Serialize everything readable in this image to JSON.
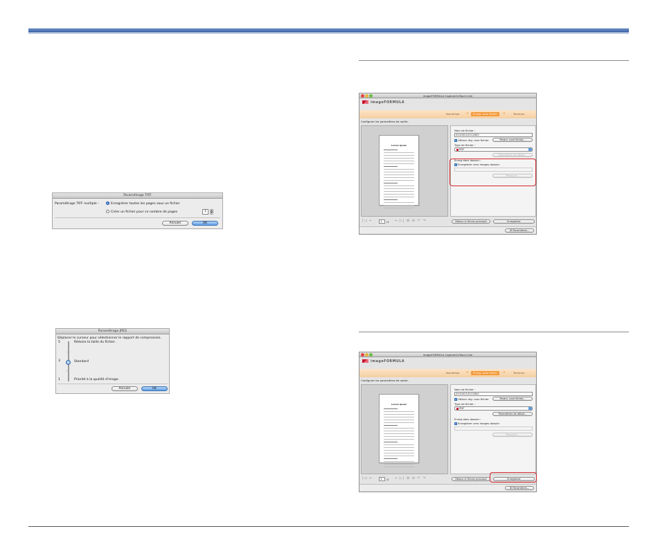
{
  "tiff_dialog": {
    "title": "Paramétrage TIFF",
    "label": "Paramétrage TIFF multiple :",
    "opt_all": "Enregistrer toutes les pages sous un fichier",
    "opt_split": "Créer un fichier pour ce nombre de pages",
    "pages_value": "1",
    "cancel": "Annuler",
    "ok": "OK"
  },
  "jpeg_dialog": {
    "title": "Paramétrage JPEG",
    "instruction": "Déplacer le curseur pour sélectionner le rapport de compression.",
    "level_top": "5",
    "level_mid": "3",
    "level_bottom": "1",
    "label_top": "Réduire la taille du fichier.",
    "label_mid": "Standard",
    "label_bottom": "Priorité à la qualité d'image.",
    "slider_level": 3,
    "cancel": "Annuler",
    "ok": "OK"
  },
  "app": {
    "window_title": "imageFORMULA CaptureOnTouch Lite",
    "logo": "imageFORMULA",
    "step_scan": "Numériser",
    "step_save": "Enreg. sous fichier",
    "step_done": "Terminer",
    "hint": "Configurer les paramètres de sortie.",
    "doc_title": "Lorem Ipsum",
    "filename_label": "Nom de fichier :",
    "filename_value": "20100210212802",
    "use_filename_rule": "Utiliser règ. nom fichier",
    "filename_rule_btn": "Param. nom fichier...",
    "filetype_label": "Type de fichier :",
    "filetype_value": "PDF",
    "detail_btn": "Paramètres de détail...",
    "folder_label": "Enreg dans dossier :",
    "save_to_images": "Enregistrer vers Images dossier",
    "browse_btn": "Parcourir...",
    "page_num": "1",
    "page_total": "/1",
    "back_btn": "Retour à l'écran principal",
    "save_btn": "Enregistrer",
    "settings_btn": "Paramètres..."
  }
}
